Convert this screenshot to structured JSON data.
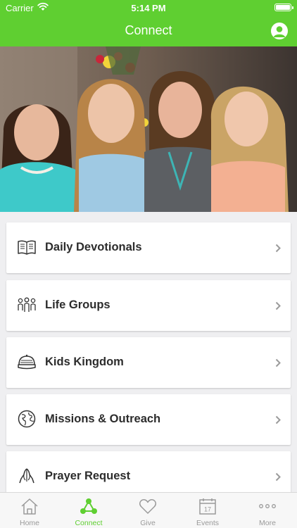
{
  "status_bar": {
    "carrier": "Carrier",
    "time": "5:14 PM"
  },
  "header": {
    "title": "Connect",
    "profile_icon": "profile-icon"
  },
  "menu": {
    "items": [
      {
        "label": "Daily Devotionals",
        "icon": "book-icon"
      },
      {
        "label": "Life Groups",
        "icon": "people-icon"
      },
      {
        "label": "Kids Kingdom",
        "icon": "cap-icon"
      },
      {
        "label": "Missions & Outreach",
        "icon": "globe-icon"
      },
      {
        "label": "Prayer Request",
        "icon": "praying-hands-icon"
      }
    ]
  },
  "tab_bar": {
    "tabs": [
      {
        "label": "Home",
        "icon": "home-icon"
      },
      {
        "label": "Connect",
        "icon": "connect-icon",
        "active": true
      },
      {
        "label": "Give",
        "icon": "heart-icon"
      },
      {
        "label": "Events",
        "icon": "calendar-icon",
        "day": "17"
      },
      {
        "label": "More",
        "icon": "more-icon"
      }
    ]
  },
  "colors": {
    "brand_green": "#5fcf31",
    "tab_inactive": "#9a9a9a"
  }
}
